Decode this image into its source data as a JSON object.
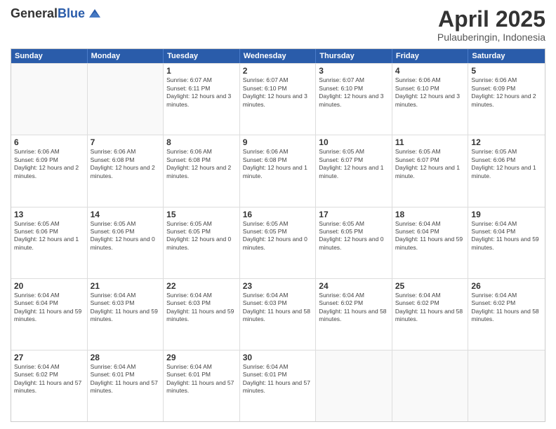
{
  "header": {
    "logo_general": "General",
    "logo_blue": "Blue",
    "month_title": "April 2025",
    "subtitle": "Pulauberingin, Indonesia"
  },
  "weekdays": [
    "Sunday",
    "Monday",
    "Tuesday",
    "Wednesday",
    "Thursday",
    "Friday",
    "Saturday"
  ],
  "rows": [
    [
      {
        "day": "",
        "text": ""
      },
      {
        "day": "",
        "text": ""
      },
      {
        "day": "1",
        "text": "Sunrise: 6:07 AM\nSunset: 6:11 PM\nDaylight: 12 hours and 3 minutes."
      },
      {
        "day": "2",
        "text": "Sunrise: 6:07 AM\nSunset: 6:10 PM\nDaylight: 12 hours and 3 minutes."
      },
      {
        "day": "3",
        "text": "Sunrise: 6:07 AM\nSunset: 6:10 PM\nDaylight: 12 hours and 3 minutes."
      },
      {
        "day": "4",
        "text": "Sunrise: 6:06 AM\nSunset: 6:10 PM\nDaylight: 12 hours and 3 minutes."
      },
      {
        "day": "5",
        "text": "Sunrise: 6:06 AM\nSunset: 6:09 PM\nDaylight: 12 hours and 2 minutes."
      }
    ],
    [
      {
        "day": "6",
        "text": "Sunrise: 6:06 AM\nSunset: 6:09 PM\nDaylight: 12 hours and 2 minutes."
      },
      {
        "day": "7",
        "text": "Sunrise: 6:06 AM\nSunset: 6:08 PM\nDaylight: 12 hours and 2 minutes."
      },
      {
        "day": "8",
        "text": "Sunrise: 6:06 AM\nSunset: 6:08 PM\nDaylight: 12 hours and 2 minutes."
      },
      {
        "day": "9",
        "text": "Sunrise: 6:06 AM\nSunset: 6:08 PM\nDaylight: 12 hours and 1 minute."
      },
      {
        "day": "10",
        "text": "Sunrise: 6:05 AM\nSunset: 6:07 PM\nDaylight: 12 hours and 1 minute."
      },
      {
        "day": "11",
        "text": "Sunrise: 6:05 AM\nSunset: 6:07 PM\nDaylight: 12 hours and 1 minute."
      },
      {
        "day": "12",
        "text": "Sunrise: 6:05 AM\nSunset: 6:06 PM\nDaylight: 12 hours and 1 minute."
      }
    ],
    [
      {
        "day": "13",
        "text": "Sunrise: 6:05 AM\nSunset: 6:06 PM\nDaylight: 12 hours and 1 minute."
      },
      {
        "day": "14",
        "text": "Sunrise: 6:05 AM\nSunset: 6:06 PM\nDaylight: 12 hours and 0 minutes."
      },
      {
        "day": "15",
        "text": "Sunrise: 6:05 AM\nSunset: 6:05 PM\nDaylight: 12 hours and 0 minutes."
      },
      {
        "day": "16",
        "text": "Sunrise: 6:05 AM\nSunset: 6:05 PM\nDaylight: 12 hours and 0 minutes."
      },
      {
        "day": "17",
        "text": "Sunrise: 6:05 AM\nSunset: 6:05 PM\nDaylight: 12 hours and 0 minutes."
      },
      {
        "day": "18",
        "text": "Sunrise: 6:04 AM\nSunset: 6:04 PM\nDaylight: 11 hours and 59 minutes."
      },
      {
        "day": "19",
        "text": "Sunrise: 6:04 AM\nSunset: 6:04 PM\nDaylight: 11 hours and 59 minutes."
      }
    ],
    [
      {
        "day": "20",
        "text": "Sunrise: 6:04 AM\nSunset: 6:04 PM\nDaylight: 11 hours and 59 minutes."
      },
      {
        "day": "21",
        "text": "Sunrise: 6:04 AM\nSunset: 6:03 PM\nDaylight: 11 hours and 59 minutes."
      },
      {
        "day": "22",
        "text": "Sunrise: 6:04 AM\nSunset: 6:03 PM\nDaylight: 11 hours and 59 minutes."
      },
      {
        "day": "23",
        "text": "Sunrise: 6:04 AM\nSunset: 6:03 PM\nDaylight: 11 hours and 58 minutes."
      },
      {
        "day": "24",
        "text": "Sunrise: 6:04 AM\nSunset: 6:02 PM\nDaylight: 11 hours and 58 minutes."
      },
      {
        "day": "25",
        "text": "Sunrise: 6:04 AM\nSunset: 6:02 PM\nDaylight: 11 hours and 58 minutes."
      },
      {
        "day": "26",
        "text": "Sunrise: 6:04 AM\nSunset: 6:02 PM\nDaylight: 11 hours and 58 minutes."
      }
    ],
    [
      {
        "day": "27",
        "text": "Sunrise: 6:04 AM\nSunset: 6:02 PM\nDaylight: 11 hours and 57 minutes."
      },
      {
        "day": "28",
        "text": "Sunrise: 6:04 AM\nSunset: 6:01 PM\nDaylight: 11 hours and 57 minutes."
      },
      {
        "day": "29",
        "text": "Sunrise: 6:04 AM\nSunset: 6:01 PM\nDaylight: 11 hours and 57 minutes."
      },
      {
        "day": "30",
        "text": "Sunrise: 6:04 AM\nSunset: 6:01 PM\nDaylight: 11 hours and 57 minutes."
      },
      {
        "day": "",
        "text": ""
      },
      {
        "day": "",
        "text": ""
      },
      {
        "day": "",
        "text": ""
      }
    ]
  ]
}
